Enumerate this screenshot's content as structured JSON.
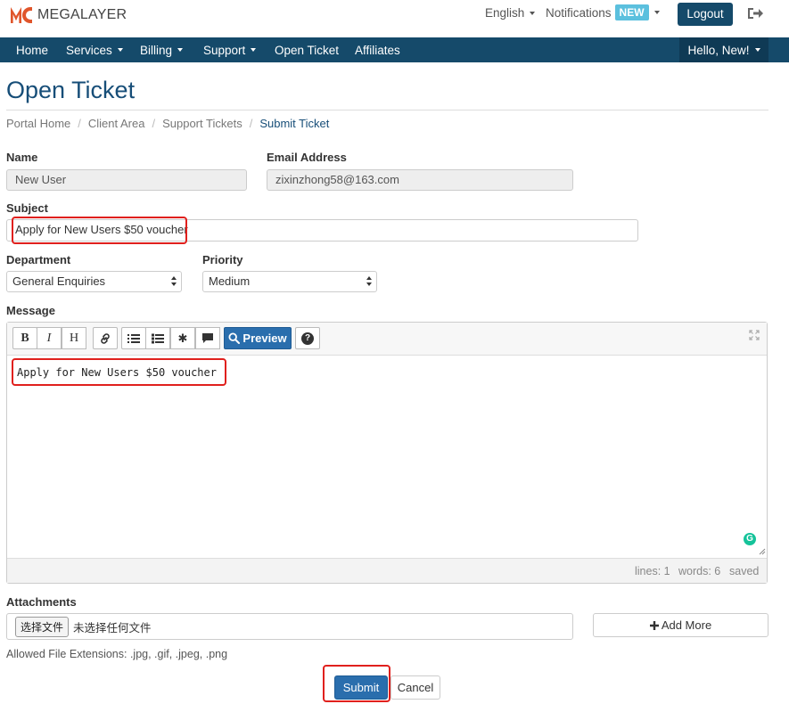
{
  "brand": {
    "name": "MEGALAYER",
    "color": "#e0552b"
  },
  "topbar": {
    "language": "English",
    "notifications": "Notifications",
    "new_badge": "NEW",
    "logout": "Logout",
    "exit_icon": "sign-out-icon"
  },
  "nav": {
    "items": [
      {
        "label": "Home"
      },
      {
        "label": "Services"
      },
      {
        "label": "Billing"
      },
      {
        "label": "Support"
      },
      {
        "label": "Open Ticket"
      },
      {
        "label": "Affiliates"
      }
    ],
    "user_greeting": "Hello, New!",
    "color": "#154a6a"
  },
  "page": {
    "title": "Open Ticket"
  },
  "breadcrumb": [
    "Portal Home",
    "Client Area",
    "Support Tickets",
    "Submit Ticket"
  ],
  "form": {
    "name_label": "Name",
    "name_value": "New User",
    "email_label": "Email Address",
    "email_value": "zixinzhong58@163.com",
    "subject_label": "Subject",
    "subject_value": "Apply for New Users $50 voucher",
    "department_label": "Department",
    "department_value": "General Enquiries",
    "priority_label": "Priority",
    "priority_value": "Medium",
    "message_label": "Message",
    "message_value": "Apply for New Users $50 voucher",
    "attachments_label": "Attachments",
    "file_button": "选择文件",
    "file_none": "未选择任何文件",
    "add_more": "Add More",
    "allowed_ext": "Allowed File Extensions: .jpg, .gif, .jpeg, .png",
    "submit": "Submit",
    "cancel": "Cancel"
  },
  "editor": {
    "toolbar": [
      {
        "icon": "bold-icon",
        "glyph": "B"
      },
      {
        "icon": "italic-icon",
        "glyph": "I"
      },
      {
        "icon": "heading-icon",
        "glyph": "H"
      },
      {
        "icon": "link-icon"
      },
      {
        "icon": "list-ul-icon"
      },
      {
        "icon": "list-ol-icon"
      },
      {
        "icon": "asterisk-icon",
        "glyph": "✱"
      },
      {
        "icon": "comment-icon"
      },
      {
        "icon": "help-icon",
        "glyph": "?"
      }
    ],
    "preview_label": "Preview",
    "status": {
      "lines": "lines: 1",
      "words": "words: 6",
      "saved": "saved"
    }
  },
  "colors": {
    "accent": "#2a6ead",
    "title": "#174e78",
    "highlight": "#e0201d"
  }
}
